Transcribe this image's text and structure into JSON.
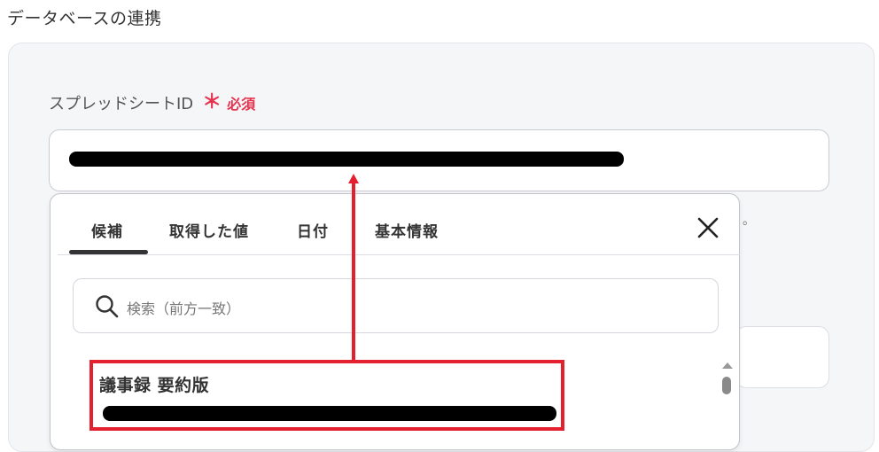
{
  "section": {
    "title": "データベースの連携"
  },
  "field": {
    "label": "スプレッドシートID",
    "required_mark": "＊",
    "required_text": "必須"
  },
  "popup": {
    "tabs": [
      {
        "label": "候補"
      },
      {
        "label": "取得した値"
      },
      {
        "label": "日付"
      },
      {
        "label": "基本情報"
      }
    ],
    "active_tab": "候補",
    "search": {
      "placeholder": "検索（前方一致）"
    },
    "items": [
      {
        "title": "議事録 要約版"
      }
    ]
  },
  "ghost_text": "。",
  "colors": {
    "required": "#e6334f",
    "annotation": "#e4202f",
    "panel_bg": "#f5f6f8"
  }
}
